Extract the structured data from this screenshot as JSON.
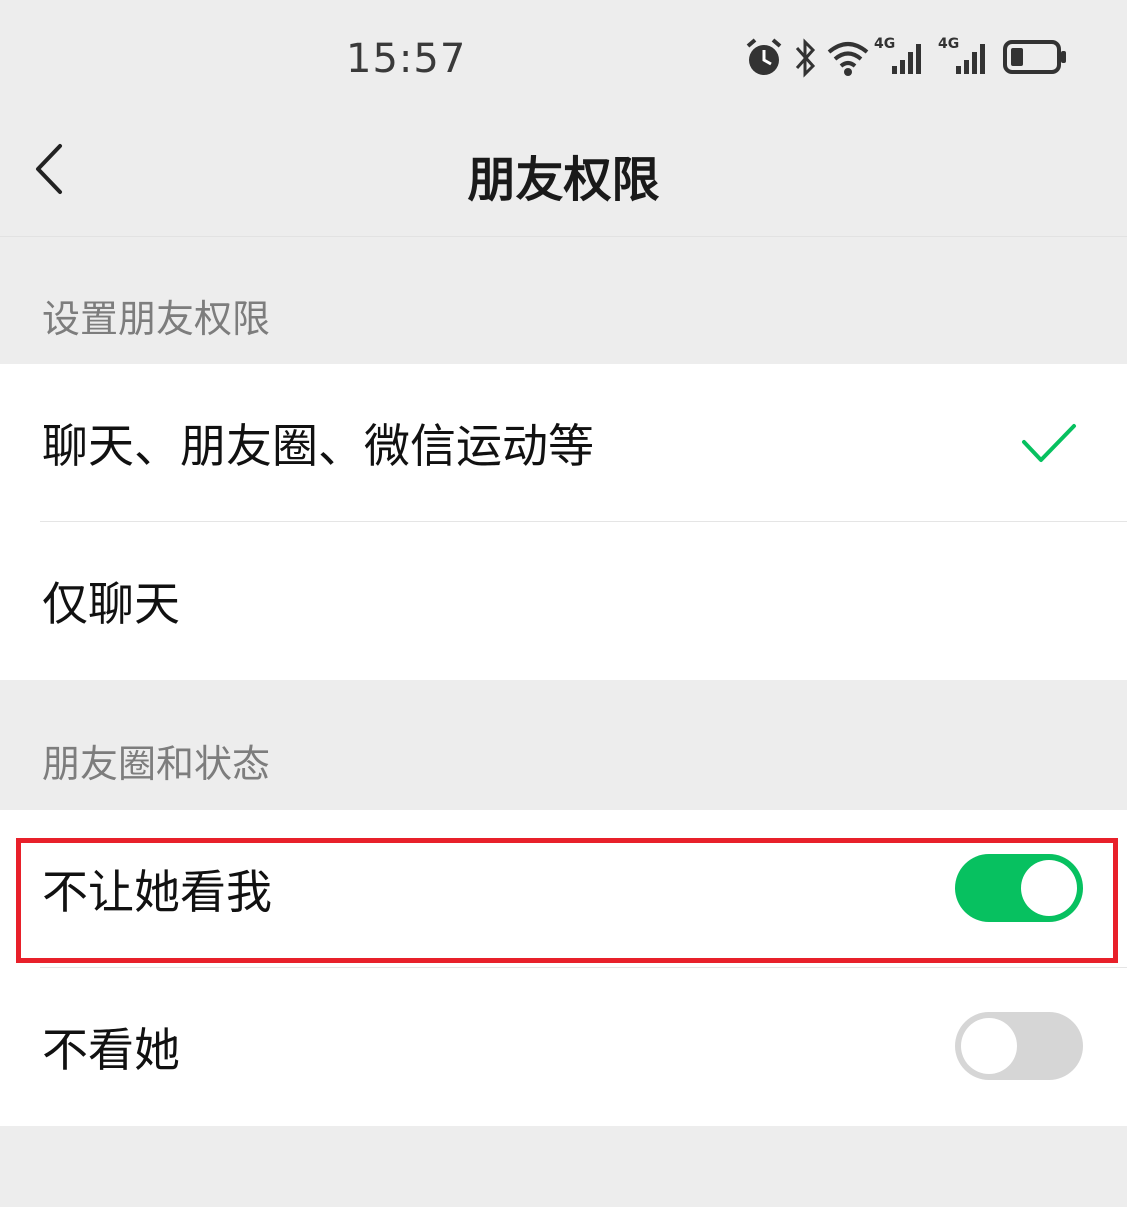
{
  "status_bar": {
    "time": "15:57",
    "icons": [
      "alarm-icon",
      "bluetooth-icon",
      "wifi-icon",
      "signal-4g-icon",
      "signal-4g-icon",
      "battery-icon"
    ],
    "network_label_1": "4G",
    "network_label_2": "4G"
  },
  "nav": {
    "back_icon": "chevron-left-icon",
    "title": "朋友权限"
  },
  "permission_section": {
    "header": "设置朋友权限",
    "options": [
      {
        "label": "聊天、朋友圈、微信运动等",
        "selected": true
      },
      {
        "label": "仅聊天",
        "selected": false
      }
    ]
  },
  "moments_section": {
    "header": "朋友圈和状态",
    "toggles": [
      {
        "label": "不让她看我",
        "on": true
      },
      {
        "label": "不看她",
        "on": false
      }
    ]
  },
  "colors": {
    "accent_green": "#07c160",
    "highlight_red": "#e8202a",
    "background": "#ededed"
  }
}
